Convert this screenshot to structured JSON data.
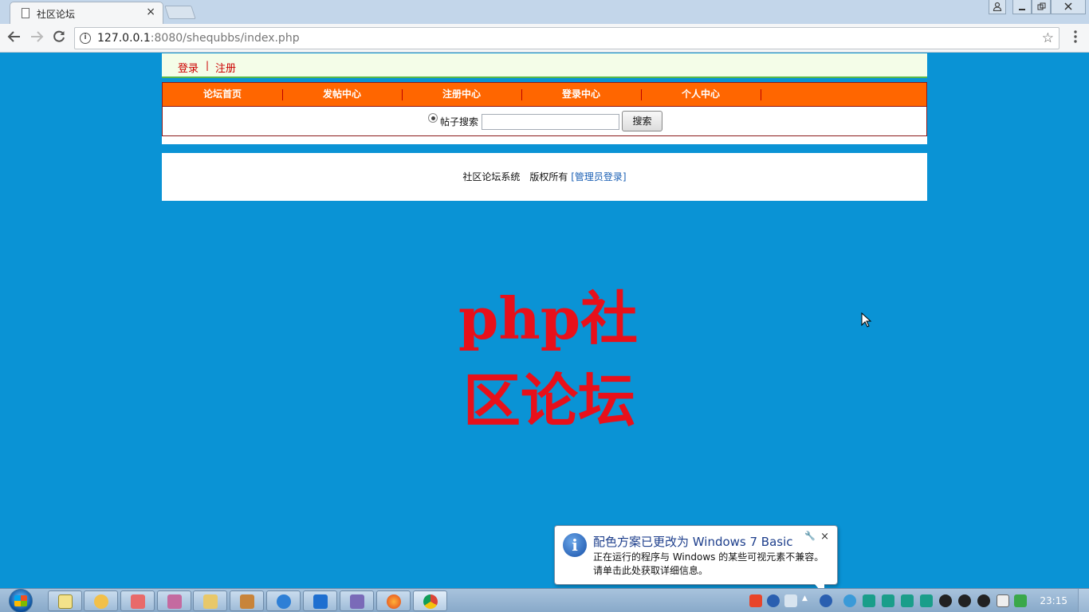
{
  "browser": {
    "tab_title": "社区论坛",
    "tab_close": "×",
    "url_host": "127.0.0.1",
    "url_rest": ":8080/shequbbs/index.php"
  },
  "site": {
    "top_links": {
      "login": "登录",
      "separator": "|",
      "register": "注册"
    },
    "nav": [
      "论坛首页",
      "发帖中心",
      "注册中心",
      "登录中心",
      "个人中心"
    ],
    "search": {
      "label": "帖子搜索",
      "input_value": "",
      "button": "搜索"
    },
    "footer": {
      "text": "社区论坛系统　版权所有",
      "admin_link": "[管理员登录]"
    },
    "big_title_line1": "php社",
    "big_title_line2": "区论坛"
  },
  "balloon": {
    "title": "配色方案已更改为 Windows 7 Basic",
    "line1": "正在运行的程序与 Windows 的某些可视元素不兼容。",
    "line2": "请单击此处获取详细信息。",
    "close": "×"
  },
  "taskbar": {
    "clock": "23:15",
    "apps": [
      "notepad-icon",
      "explorer-search-icon",
      "paint-icon",
      "database-icon",
      "folder-icon",
      "book-icon",
      "ie-icon",
      "teamviewer-icon",
      "visual-studio-icon",
      "firefox-icon",
      "chrome-icon"
    ],
    "active_app": "chrome-icon"
  },
  "colors": {
    "page_bg": "#0a93d5",
    "nav_bg": "#ff6600",
    "title_red": "#e8101a",
    "link_red": "#cc0000"
  }
}
